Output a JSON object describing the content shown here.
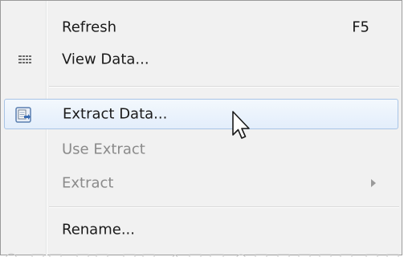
{
  "menu": {
    "items": [
      {
        "label": "Refresh",
        "shortcut": "F5"
      },
      {
        "label": "View Data...",
        "icon": "grid-icon"
      },
      {
        "label": "Extract Data...",
        "icon": "extract-data-icon"
      },
      {
        "label": "Use Extract"
      },
      {
        "label": "Extract"
      },
      {
        "label": "Rename..."
      }
    ]
  },
  "colors": {
    "menu_bg": "#f1f1f1",
    "highlight_border": "#a8c4e6",
    "disabled_text": "#8a8a8a"
  }
}
